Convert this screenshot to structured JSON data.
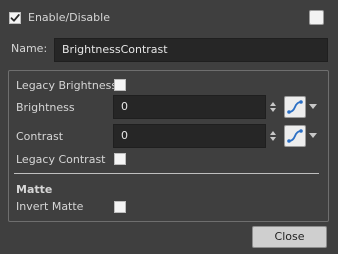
{
  "header": {
    "enable_label": "Enable/Disable",
    "enable_checked": true,
    "top_right_checked": false
  },
  "name_field": {
    "label": "Name:",
    "value": "BrightnessContrast"
  },
  "group": {
    "legacy_brightness": {
      "label": "Legacy Brightness",
      "checked": false
    },
    "brightness": {
      "label": "Brightness",
      "value": "0"
    },
    "contrast": {
      "label": "Contrast",
      "value": "0"
    },
    "legacy_contrast": {
      "label": "Legacy Contrast",
      "checked": false
    }
  },
  "matte": {
    "heading": "Matte",
    "invert_label": "Invert Matte",
    "invert_checked": false
  },
  "footer": {
    "close_label": "Close"
  },
  "colors": {
    "background": "#3f3f3f",
    "field": "#262626",
    "accent_blue": "#2b6fc4"
  },
  "icons": [
    "checkmark-icon",
    "spin-arrows-icon",
    "function-curve-icon",
    "chevron-down-icon"
  ]
}
